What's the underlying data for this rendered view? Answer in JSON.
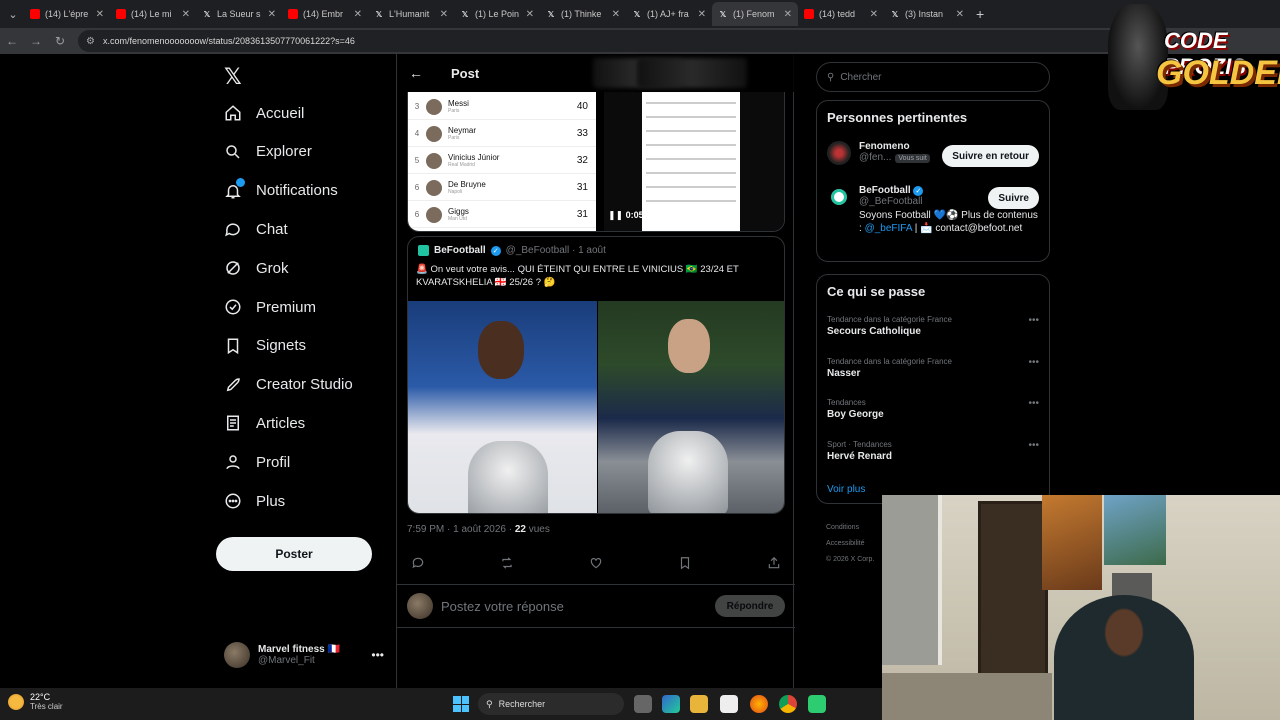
{
  "browser": {
    "tabs": [
      {
        "icon": "youtube",
        "title": "(14) L'épre"
      },
      {
        "icon": "youtube",
        "title": "(14) Le mi"
      },
      {
        "icon": "x",
        "title": "La Sueur s"
      },
      {
        "icon": "youtube",
        "title": "(14) Embr"
      },
      {
        "icon": "x",
        "title": "L'Humanit"
      },
      {
        "icon": "x",
        "title": "(1) Le Poin"
      },
      {
        "icon": "x",
        "title": "(1) Thinke"
      },
      {
        "icon": "x",
        "title": "(1) AJ+ fra"
      },
      {
        "icon": "x",
        "title": "(1) Fenom",
        "active": true
      },
      {
        "icon": "youtube",
        "title": "(14) tedd"
      },
      {
        "icon": "x",
        "title": "(3) Instan"
      }
    ],
    "url": "x.com/fenomenooooooow/status/2083613507770061222?s=46"
  },
  "nav": {
    "items": [
      {
        "label": "Accueil",
        "icon": "home-icon"
      },
      {
        "label": "Explorer",
        "icon": "search-icon"
      },
      {
        "label": "Notifications",
        "icon": "bell-icon"
      },
      {
        "label": "Chat",
        "icon": "chat-icon"
      },
      {
        "label": "Grok",
        "icon": "grok-icon"
      },
      {
        "label": "Premium",
        "icon": "premium-icon"
      },
      {
        "label": "Signets",
        "icon": "bookmark-icon"
      },
      {
        "label": "Creator Studio",
        "icon": "rocket-icon"
      },
      {
        "label": "Articles",
        "icon": "article-icon"
      },
      {
        "label": "Profil",
        "icon": "profile-icon"
      },
      {
        "label": "Plus",
        "icon": "more-icon"
      }
    ],
    "post_button": "Poster",
    "account": {
      "name": "Marvel fitness 🇫🇷",
      "handle": "@Marvel_Fit"
    }
  },
  "post": {
    "header": "Post",
    "ranking": [
      {
        "rank": "3",
        "name": "Messi",
        "club": "Paris",
        "value": "40"
      },
      {
        "rank": "4",
        "name": "Neymar",
        "club": "Paris",
        "value": "33"
      },
      {
        "rank": "5",
        "name": "Vinicius Júnior",
        "club": "Real Madrid",
        "value": "32"
      },
      {
        "rank": "6",
        "name": "De Bruyne",
        "club": "Napoli",
        "value": "31"
      },
      {
        "rank": "6",
        "name": "Giggs",
        "club": "Man Utd",
        "value": "31"
      }
    ],
    "video_time": "0:05",
    "quote": {
      "author": "BeFootball",
      "handle": "@_BeFootball",
      "date": "1 août",
      "text": "🚨 On veut votre avis... QUI ÉTEINT QUI ENTRE LE VINICIUS 🇧🇷 23/24 ET KVARATSKHELIA 🇬🇪 25/26 ? 🤔"
    },
    "timestamp": "7:59 PM · 1 août 2026 · ",
    "views_count": "22",
    "views_label": "vues",
    "reply_placeholder": "Postez votre réponse",
    "reply_button": "Répondre"
  },
  "sidebar": {
    "search_placeholder": "Chercher",
    "relevant_title": "Personnes pertinentes",
    "people": [
      {
        "name": "Fenomeno",
        "handle": "@fen...",
        "tag": "Vous suit",
        "button": "Suivre en retour"
      },
      {
        "name": "BeFootball",
        "handle": "@_BeFootball",
        "bio": "Soyons Football 💙⚽ Plus de contenus : ",
        "bio_link": "@_beFIFA",
        "bio_tail": " | 📩 contact@befoot.net",
        "button": "Suivre"
      }
    ],
    "happening_title": "Ce qui se passe",
    "trends": [
      {
        "category": "Tendance dans la catégorie France",
        "name": "Secours Catholique"
      },
      {
        "category": "Tendance dans la catégorie France",
        "name": "Nasser"
      },
      {
        "category": "Tendances",
        "name": "Boy George"
      },
      {
        "category": "Sport · Tendances",
        "name": "Hervé Renard"
      }
    ],
    "see_more": "Voir plus",
    "footer": [
      "Conditions",
      "Accessibilité",
      "© 2026 X Corp."
    ]
  },
  "overlay": {
    "logo_line1": "CODE PROZIS",
    "logo_line2": "GOLDENG"
  },
  "taskbar": {
    "temp": "22°C",
    "weather": "Très clair",
    "search": "Rechercher"
  },
  "colors": {
    "accent": "#1d9bf0",
    "background": "#000000",
    "text": "#e7e9ea",
    "muted": "#71767b"
  }
}
